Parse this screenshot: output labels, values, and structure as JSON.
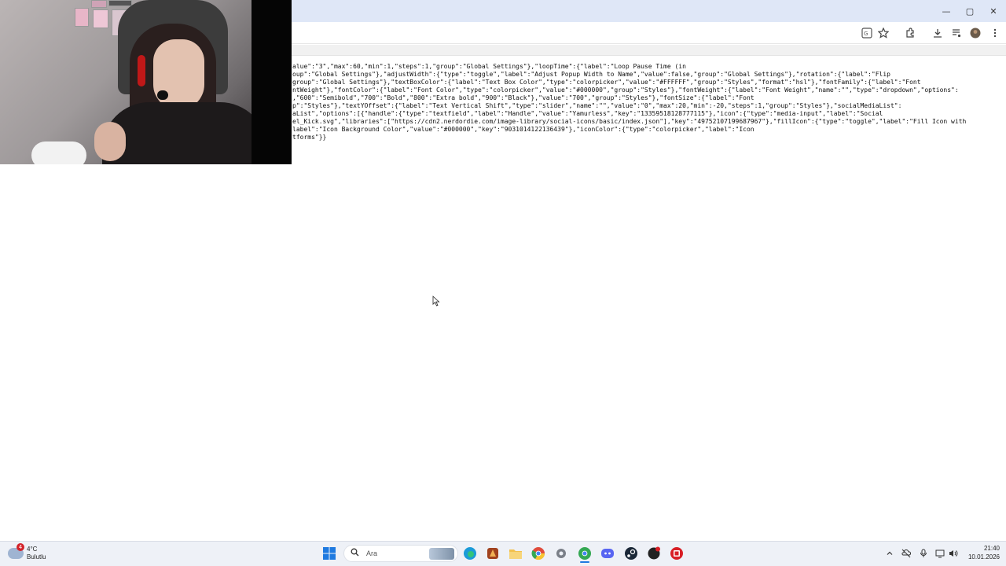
{
  "browser": {
    "window_controls": {
      "minimize": "—",
      "maximize": "▢",
      "close": "✕"
    }
  },
  "page": {
    "json_lines": [
      "alue\":\"3\",\"max\":60,\"min\":1,\"steps\":1,\"group\":\"Global Settings\"},\"loopTime\":{\"label\":\"Loop Pause Time (in",
      "oup\":\"Global Settings\"},\"adjustWidth\":{\"type\":\"toggle\",\"label\":\"Adjust Popup Width to Name\",\"value\":false,\"group\":\"Global Settings\"},\"rotation\":{\"label\":\"Flip",
      "group\":\"Global Settings\"},\"textBoxColor\":{\"label\":\"Text Box Color\",\"type\":\"colorpicker\",\"value\":\"#FFFFFF\",\"group\":\"Styles\",\"format\":\"hsl\"},\"fontFamily\":{\"label\":\"Font",
      "ntWeight\"},\"fontColor\":{\"label\":\"Font Color\",\"type\":\"colorpicker\",\"value\":\"#000000\",\"group\":\"Styles\"},\"fontWeight\":{\"label\":\"Font Weight\",\"name\":\"\",\"type\":\"dropdown\",\"options\":",
      ",\"600\":\"Semibold\",\"700\":\"Bold\",\"800\":\"Extra bold\",\"900\":\"Black\"},\"value\":\"700\",\"group\":\"Styles\"},\"fontSize\":{\"label\":\"Font",
      "p\":\"Styles\"},\"textYOffset\":{\"label\":\"Text Vertical Shift\",\"type\":\"slider\",\"name\":\"\",\"value\":\"0\",\"max\":20,\"min\":-20,\"steps\":1,\"group\":\"Styles\"},\"socialMediaList\":",
      "aList\",\"options\":[{\"handle\":{\"type\":\"textfield\",\"label\":\"Handle\",\"value\":\"Yamurless\",\"key\":\"13359518128777115\"},\"icon\":{\"type\":\"media-input\",\"label\":\"Social",
      "el_Kick.svg\",\"libraries\":[\"https://cdn2.nerdordie.com/image-library/social-icons/basic/index.json\"],\"key\":\"49752107199687967\"},\"fillIcon\":{\"type\":\"toggle\",\"label\":\"Fill Icon with",
      "label\":\"Icon Background Color\",\"value\":\"#000000\",\"key\":\"9031014122136439\"},\"iconColor\":{\"type\":\"colorpicker\",\"label\":\"Icon",
      "tforms\"}}"
    ]
  },
  "taskbar": {
    "weather": {
      "badge": "4",
      "temp": "4°C",
      "condition": "Bulutlu"
    },
    "search_label": "Ara",
    "clock": {
      "time": "21:40",
      "date": "10.01.2026"
    },
    "colors": {
      "start": "#1f7ae0",
      "edge": "#1b9bd8",
      "files": "#f2c14e",
      "chrome": "#e04b3c",
      "steam": "#1b2838",
      "discord": "#5865f2",
      "app_red": "#d81f26"
    }
  }
}
